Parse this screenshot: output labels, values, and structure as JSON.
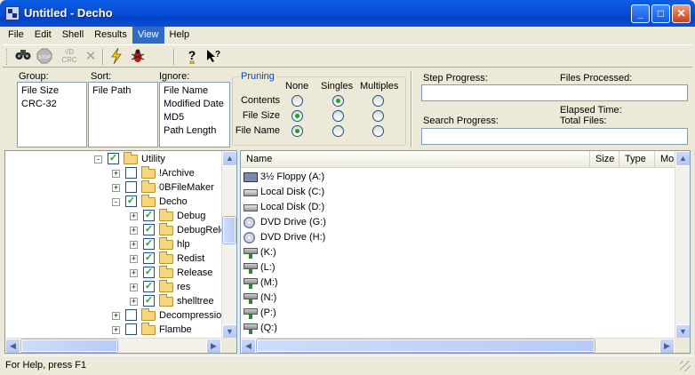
{
  "window": {
    "title": "Untitled - Decho"
  },
  "menu": [
    "File",
    "Edit",
    "Shell",
    "Results",
    "View",
    "Help"
  ],
  "menu_active": "View",
  "toolbar": {
    "icons": [
      "binoculars-icon",
      "stop-icon",
      "crc-icon",
      "delete-x-icon",
      "lightning-icon",
      "bug-icon",
      "help-icon",
      "context-help-icon"
    ],
    "stop_label": "STOP",
    "crc_label": "CRC"
  },
  "options": {
    "group_label": "Group:",
    "group_items": [
      "File Size",
      "CRC-32"
    ],
    "sort_label": "Sort:",
    "sort_items": [
      "File Path"
    ],
    "ignore_label": "Ignore:",
    "ignore_items": [
      "File Name",
      "Modified Date",
      "MD5",
      "Path Length"
    ],
    "pruning_label": "Pruning",
    "pruning_columns": [
      "None",
      "Singles",
      "Multiples"
    ],
    "pruning_rows": [
      {
        "label": "Contents",
        "selected": "Singles"
      },
      {
        "label": "File Size",
        "selected": "None"
      },
      {
        "label": "File Name",
        "selected": "None"
      }
    ]
  },
  "progress": {
    "step_label": "Step Progress:",
    "files_processed_label": "Files Processed:",
    "search_label": "Search Progress:",
    "elapsed_label": "Elapsed Time:",
    "total_files_label": "Total Files:"
  },
  "tree": [
    {
      "label": "Utility",
      "level": 0,
      "expander": "-",
      "checked": true
    },
    {
      "label": "!Archive",
      "level": 1,
      "expander": "+",
      "checked": false
    },
    {
      "label": "0BFileMaker",
      "level": 1,
      "expander": "+",
      "checked": false
    },
    {
      "label": "Decho",
      "level": 1,
      "expander": "-",
      "checked": true
    },
    {
      "label": "Debug",
      "level": 2,
      "expander": "+",
      "checked": true
    },
    {
      "label": "DebugRele",
      "level": 2,
      "expander": "+",
      "checked": true
    },
    {
      "label": "hlp",
      "level": 2,
      "expander": "+",
      "checked": true
    },
    {
      "label": "Redist",
      "level": 2,
      "expander": "+",
      "checked": true
    },
    {
      "label": "Release",
      "level": 2,
      "expander": "+",
      "checked": true
    },
    {
      "label": "res",
      "level": 2,
      "expander": "+",
      "checked": true
    },
    {
      "label": "shelltree",
      "level": 2,
      "expander": "+",
      "checked": true
    },
    {
      "label": "Decompression",
      "level": 1,
      "expander": "+",
      "checked": false
    },
    {
      "label": "Flambe",
      "level": 1,
      "expander": "+",
      "checked": false
    }
  ],
  "file_list": {
    "columns": [
      "Name",
      "Size",
      "Type",
      "Mo"
    ],
    "rows": [
      {
        "name": "3½ Floppy (A:)",
        "icon": "floppy"
      },
      {
        "name": "Local Disk (C:)",
        "icon": "disk"
      },
      {
        "name": "Local Disk (D:)",
        "icon": "disk"
      },
      {
        "name": "DVD Drive (G:)",
        "icon": "dvd"
      },
      {
        "name": "DVD Drive (H:)",
        "icon": "dvd"
      },
      {
        "name": "(K:)",
        "icon": "net"
      },
      {
        "name": "(L:)",
        "icon": "net"
      },
      {
        "name": "(M:)",
        "icon": "net"
      },
      {
        "name": "(N:)",
        "icon": "net"
      },
      {
        "name": "(P:)",
        "icon": "net"
      },
      {
        "name": "(Q:)",
        "icon": "net"
      }
    ]
  },
  "status": {
    "text": "For Help, press F1"
  }
}
